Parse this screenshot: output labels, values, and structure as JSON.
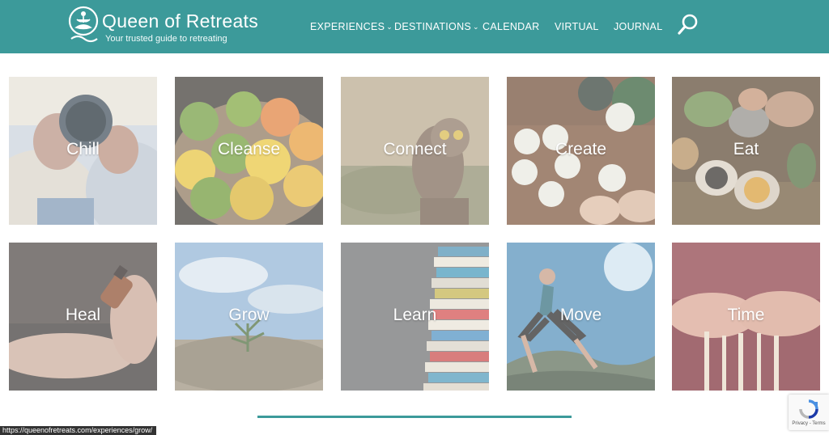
{
  "brand": {
    "name": "Queen of Retreats",
    "tagline": "Your trusted guide to retreating",
    "accent": "#3c9a9a"
  },
  "nav": {
    "items": [
      {
        "label": "EXPERIENCES",
        "has_dropdown": true
      },
      {
        "label": "DESTINATIONS",
        "has_dropdown": true
      },
      {
        "label": "CALENDAR",
        "has_dropdown": false
      },
      {
        "label": "VIRTUAL",
        "has_dropdown": false
      },
      {
        "label": "JOURNAL",
        "has_dropdown": false
      }
    ],
    "search_icon": "search-icon"
  },
  "experiences": [
    {
      "label": "Chill"
    },
    {
      "label": "Cleanse"
    },
    {
      "label": "Connect"
    },
    {
      "label": "Create"
    },
    {
      "label": "Eat"
    },
    {
      "label": "Heal"
    },
    {
      "label": "Grow"
    },
    {
      "label": "Learn"
    },
    {
      "label": "Move"
    },
    {
      "label": "Time"
    }
  ],
  "status_bar": {
    "url": "https://queenofretreats.com/experiences/grow/"
  },
  "recaptcha": {
    "links": "Privacy - Terms"
  }
}
